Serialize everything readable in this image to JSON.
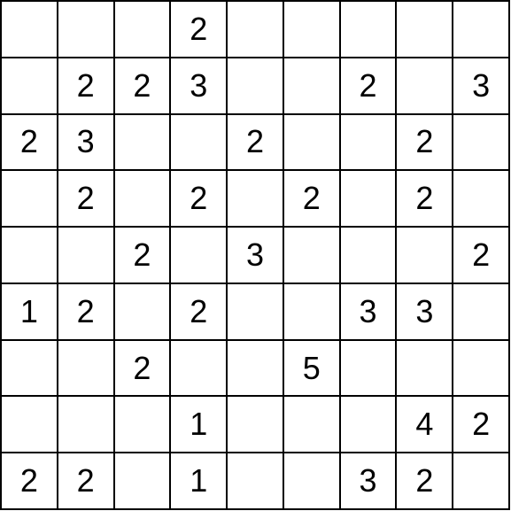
{
  "grid": {
    "rows": 9,
    "cols": 9,
    "cells": [
      [
        "",
        "",
        "",
        "2",
        "",
        "",
        "",
        "",
        ""
      ],
      [
        "",
        "2",
        "2",
        "3",
        "",
        "",
        "2",
        "",
        "3"
      ],
      [
        "2",
        "3",
        "",
        "",
        "2",
        "",
        "",
        "2",
        ""
      ],
      [
        "",
        "2",
        "",
        "2",
        "",
        "2",
        "",
        "2",
        ""
      ],
      [
        "",
        "",
        "2",
        "",
        "3",
        "",
        "",
        "",
        "2"
      ],
      [
        "1",
        "2",
        "",
        "2",
        "",
        "",
        "3",
        "3",
        ""
      ],
      [
        "",
        "",
        "2",
        "",
        "",
        "5",
        "",
        "",
        ""
      ],
      [
        "",
        "",
        "",
        "1",
        "",
        "",
        "",
        "4",
        "2"
      ],
      [
        "2",
        "2",
        "",
        "1",
        "",
        "",
        "3",
        "2",
        ""
      ]
    ]
  },
  "chart_data": {
    "type": "table",
    "title": "",
    "rows": 9,
    "cols": 9,
    "values": [
      [
        null,
        null,
        null,
        2,
        null,
        null,
        null,
        null,
        null
      ],
      [
        null,
        2,
        2,
        3,
        null,
        null,
        2,
        null,
        3
      ],
      [
        2,
        3,
        null,
        null,
        2,
        null,
        null,
        2,
        null
      ],
      [
        null,
        2,
        null,
        2,
        null,
        2,
        null,
        2,
        null
      ],
      [
        null,
        null,
        2,
        null,
        3,
        null,
        null,
        null,
        2
      ],
      [
        1,
        2,
        null,
        2,
        null,
        null,
        3,
        3,
        null
      ],
      [
        null,
        null,
        2,
        null,
        null,
        5,
        null,
        null,
        null
      ],
      [
        null,
        null,
        null,
        1,
        null,
        null,
        null,
        4,
        2
      ],
      [
        2,
        2,
        null,
        1,
        null,
        null,
        3,
        2,
        null
      ]
    ]
  }
}
